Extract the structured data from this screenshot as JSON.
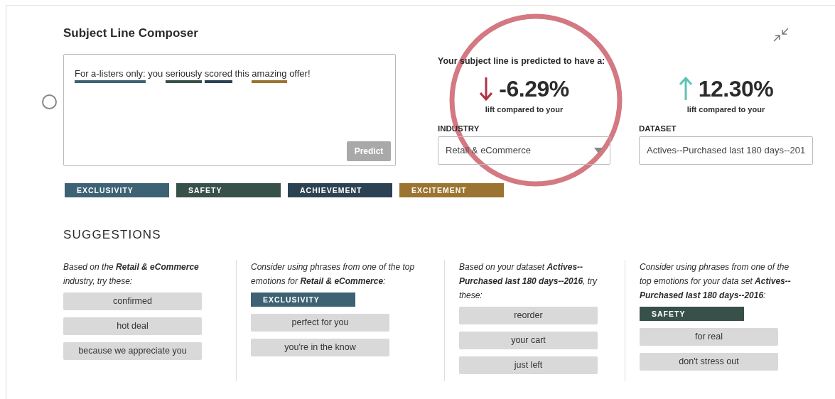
{
  "title": "Subject Line Composer",
  "composer": {
    "selected": false,
    "segments": [
      {
        "text": "For a-listers only:",
        "color": "#3d6273"
      },
      {
        "text": "you"
      },
      {
        "text": "seriously",
        "color": "#38504a"
      },
      {
        "text": "scored",
        "color": "#2c4252"
      },
      {
        "text": "this"
      },
      {
        "text": "amazing",
        "color": "#9a7430"
      },
      {
        "text": "offer!"
      }
    ],
    "button": {
      "label": "Predict",
      "disabled": true
    }
  },
  "emotions": [
    {
      "label": "EXCLUSIVITY",
      "color": "#3d6273"
    },
    {
      "label": "SAFETY",
      "color": "#38504a"
    },
    {
      "label": "ACHIEVEMENT",
      "color": "#2c4252"
    },
    {
      "label": "EXCITEMENT",
      "color": "#9a7430"
    }
  ],
  "prediction": {
    "heading": "Your subject line is predicted to have a:",
    "metrics": [
      {
        "kind": "down",
        "value": "-6.29%",
        "caption": "lift compared to your",
        "field": {
          "kind": "select",
          "label": "INDUSTRY",
          "value": "Retail & eCommerce"
        }
      },
      {
        "kind": "up",
        "value": "12.30%",
        "caption": "lift compared to your",
        "field": {
          "kind": "text",
          "label": "DATASET",
          "value": "Actives--Purchased last 180 days--201"
        }
      }
    ]
  },
  "suggestions": {
    "heading": "SUGGESTIONS",
    "columns": [
      {
        "intro": "Based on the **Retail & eCommerce** industry, try these:",
        "phrases": [
          "confirmed",
          "hot deal",
          "because we appreciate you"
        ]
      },
      {
        "intro": "Consider using phrases from one of the top emotions for **Retail & eCommerce**:",
        "emotion": {
          "label": "EXCLUSIVITY",
          "color": "#3d6273"
        },
        "phrases": [
          "perfect for you",
          "you're in the know"
        ]
      },
      {
        "intro": "Based on your dataset **Actives--Purchased last 180 days--2016**, try these:",
        "phrases": [
          "reorder",
          "your cart",
          "just left"
        ]
      },
      {
        "intro": "Consider using phrases from one of the top emotions for your data set **Actives--Purchased last 180 days--2016**:",
        "emotion": {
          "label": "SAFETY",
          "color": "#38504a"
        },
        "phrases": [
          "for real",
          "don't stress out"
        ]
      }
    ]
  }
}
